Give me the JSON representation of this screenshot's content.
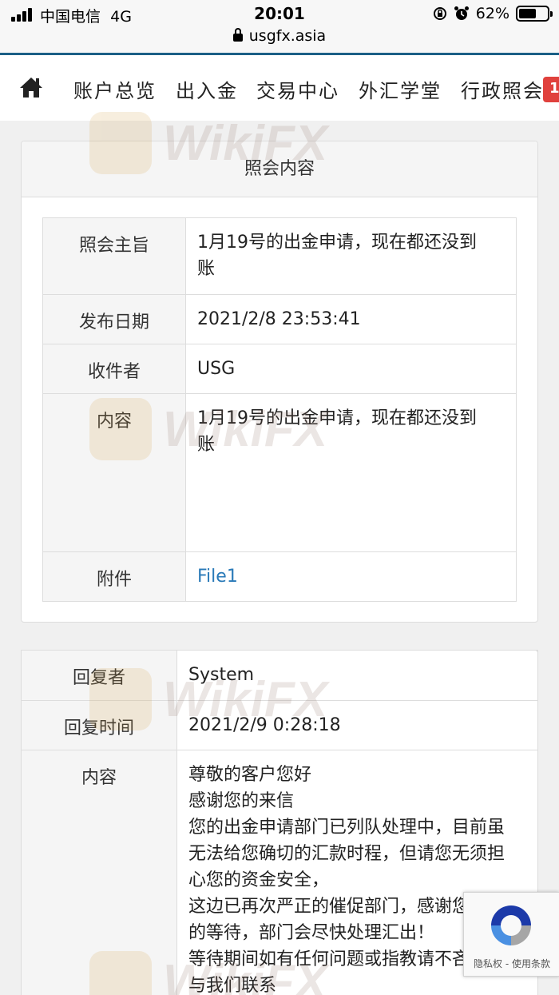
{
  "status_bar": {
    "carrier": "中国电信",
    "network": "4G",
    "time": "20:01",
    "battery": "62%",
    "battery_level": 0.62
  },
  "browser": {
    "url": "usgfx.asia"
  },
  "nav": {
    "items": [
      "账户总览",
      "出入金",
      "交易中心",
      "外汇学堂",
      "行政照会"
    ],
    "badge": "1"
  },
  "notice": {
    "title": "照会内容",
    "rows": [
      {
        "label": "照会主旨",
        "value": "1月19号的出金申请，现在都还没到账"
      },
      {
        "label": "发布日期",
        "value": "2021/2/8 23:53:41"
      },
      {
        "label": "收件者",
        "value": "USG"
      },
      {
        "label": "内容",
        "value": "1月19号的出金申请，现在都还没到账"
      },
      {
        "label": "附件",
        "value": "File1"
      }
    ]
  },
  "reply": {
    "rows": [
      {
        "label": "回复者",
        "value": "System"
      },
      {
        "label": "回复时间",
        "value": "2021/2/9 0:28:18"
      },
      {
        "label": "内容",
        "lines": [
          "尊敬的客户您好",
          "感谢您的来信",
          "您的出金申请部门已列队处理中，目前虽无法给您确切的汇款时程，但请您无须担心您的资金安全，",
          "这边已再次严正的催促部门，感谢您耐心的等待，部门会尽快处理汇出！",
          "等待期间如有任何问题或指教请不吝及时与我们联系"
        ]
      }
    ]
  },
  "watermark": "WikiFX",
  "recaptcha": {
    "privacy": "隐私权",
    "separator": " - ",
    "terms": "使用条款"
  }
}
